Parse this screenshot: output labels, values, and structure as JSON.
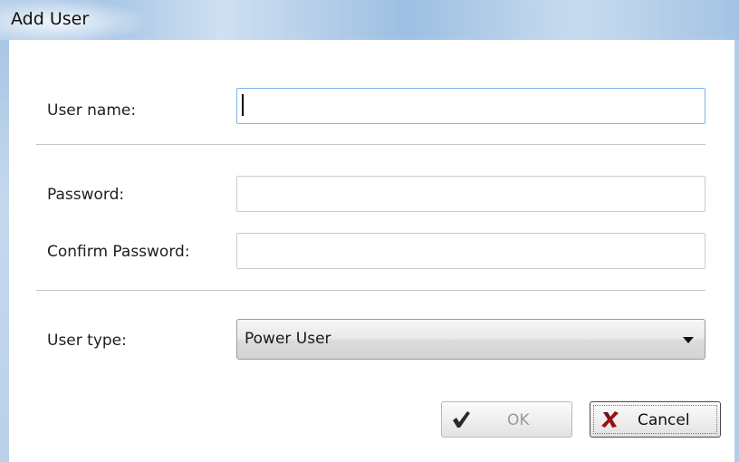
{
  "window": {
    "title": "Add User"
  },
  "form": {
    "username_label": "User name:",
    "username_value": "",
    "password_label": "Password:",
    "password_value": "",
    "confirm_label": "Confirm Password:",
    "confirm_value": "",
    "usertype_label": "User type:",
    "usertype_value": "Power User"
  },
  "buttons": {
    "ok_label": "OK",
    "cancel_label": "Cancel"
  },
  "icons": {
    "ok": "checkmark-icon",
    "cancel": "x-mark-icon",
    "dropdown": "chevron-down-icon"
  },
  "colors": {
    "titlebar": "#a9c7e6",
    "ok_icon": "#2b2b2b",
    "cancel_icon": "#9b1010"
  }
}
